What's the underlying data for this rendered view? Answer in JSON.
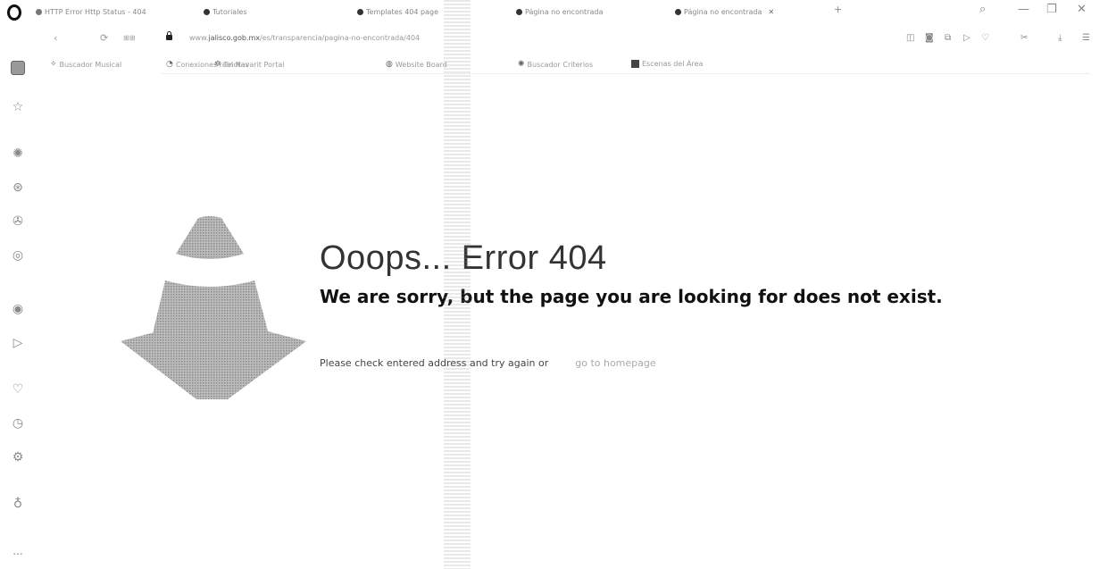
{
  "tabs": [
    {
      "label": "HTTP Error Http Status - 404"
    },
    {
      "label": "Tutoriales"
    },
    {
      "label": "Templates 404 page"
    },
    {
      "label": "Página no encontrada"
    },
    {
      "label": "Página no encontrada"
    }
  ],
  "address": {
    "url_prefix": "www.",
    "url_domain": "jalisco.gob.mx",
    "url_path": "/es/transparencia/pagina-no-encontrada/404"
  },
  "bookmarks": [
    {
      "label": "Buscador Musical"
    },
    {
      "label": "Conexiones remotas"
    },
    {
      "label": "Tel Navarit Portal"
    },
    {
      "label": "Website Board"
    },
    {
      "label": "Buscador Criterios"
    },
    {
      "label": "Escenas del Área"
    }
  ],
  "error": {
    "title": "Ooops... Error 404",
    "subtitle": "We are sorry, but the page you are looking for does not exist.",
    "message": "Please check entered address and try again or",
    "link": "go to homepage"
  },
  "sidebar": {
    "more_label": "..."
  },
  "icons": {
    "opera": "opera-logo-icon",
    "back": "back-arrow-icon",
    "reload": "reload-icon",
    "cone": "traffic-cone-icon"
  }
}
